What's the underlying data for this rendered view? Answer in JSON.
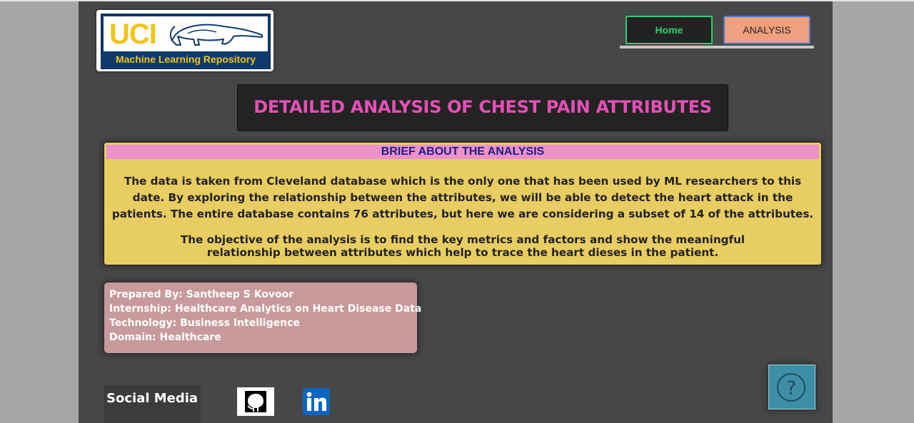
{
  "logo": {
    "uci": "UCI",
    "tagline": "Machine Learning Repository",
    "anteater_icon": "anteater-icon"
  },
  "nav": {
    "home_label": "Home",
    "analysis_label": "ANALYSIS"
  },
  "title": "DETAILED ANALYSIS OF CHEST PAIN ATTRIBUTES",
  "brief": {
    "heading": "BRIEF ABOUT THE ANALYSIS",
    "paragraph1": "The data is taken from Cleveland database which is the only one that has been used by ML researchers to this date. By exploring the relationship between the attributes, we will be able to detect the heart attack in the patients. The entire database contains 76 attributes, but here we are considering a subset of 14 of the attributes.",
    "paragraph2": "The objective of the analysis is to find the key metrics and factors and show the meaningful relationship between attributes which help to trace the heart dieses in the patient."
  },
  "prepared": {
    "by": "Prepared By: Santheep S Kovoor",
    "internship": "Internship: Healthcare Analytics on Heart Disease Data",
    "technology": "Technology: Business Intelligence",
    "domain": "Domain: Healthcare"
  },
  "social": {
    "label": "Social Media",
    "github_icon": "github-icon",
    "linkedin_icon": "linkedin-icon"
  },
  "help": {
    "glyph": "?",
    "icon": "help-icon"
  },
  "colors": {
    "page_bg": "#474747",
    "title_pink": "#e550b6",
    "brief_yellow": "#e8cd62",
    "brief_header_pink": "#ee90cb",
    "prepared_bg": "#c89a9c",
    "home_green": "#2ecc71",
    "analysis_salmon": "#f0a07e",
    "help_teal": "#3e8fa6",
    "linkedin_blue": "#0a66c2"
  }
}
